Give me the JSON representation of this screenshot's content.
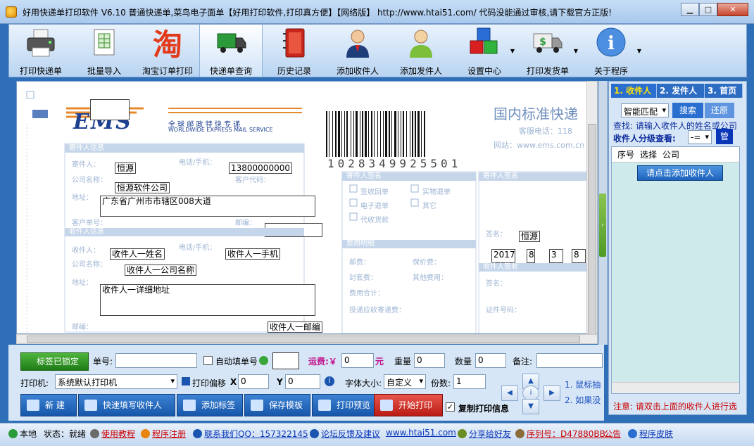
{
  "window": {
    "title": "好用快递单打印软件 V6.10 普通快递单,菜鸟电子面单【好用打印软件,打印真方便】【网络版】   http://www.htai51.com/  代码没能通过审核,请下载官方正版!"
  },
  "toolbar": {
    "items": [
      {
        "label": "打印快递单",
        "icon": "printer-icon"
      },
      {
        "label": "批量导入",
        "icon": "spreadsheet-icon"
      },
      {
        "label": "淘宝订单打印",
        "icon": "taobao-icon",
        "glyph": "淘"
      },
      {
        "label": "快递单查询",
        "icon": "delivery-truck-icon"
      },
      {
        "label": "历史记录",
        "icon": "notebook-icon"
      },
      {
        "label": "添加收件人",
        "icon": "user-icon"
      },
      {
        "label": "添加发件人",
        "icon": "sender-user-icon"
      },
      {
        "label": "设置中心",
        "icon": "cubes-icon"
      },
      {
        "label": "打印发货单",
        "icon": "money-truck-icon"
      },
      {
        "label": "关于程序",
        "icon": "info-icon",
        "glyph": "i"
      }
    ]
  },
  "waybill": {
    "brand": "EMS",
    "brand_sub_cn": "全 球 邮 政 特 快 专 递",
    "brand_sub_en": "WORLDWIDE EXPRESS MAIL SERVICE",
    "header_cn": "国内标准快递",
    "hotline": "客服电话：118",
    "website": "网站：www.ems.com.cn",
    "barcode_number": "1028349925501",
    "sender_name": "恒源",
    "sender_phone": "13800000000",
    "sender_company": "恒源软件公司",
    "sender_address": "广东省广州市市辖区008大道",
    "recv_name": "收件人一姓名",
    "recv_phone": "收件人一手机",
    "recv_company": "收件人一公司名称",
    "recv_address": "收件人一详细地址",
    "recv_zip": "收件人一邮编",
    "sign_name": "恒源",
    "date_year": "2017",
    "date_month": "8",
    "date_day": "3",
    "date_extra": "8",
    "labels": {
      "sender_section": "寄件人信息",
      "sender_name": "寄件人：",
      "sender_phone": "电话/手机：",
      "sender_company": "公司名称：",
      "sender_address": "地址：",
      "customer_no": "客户单号：",
      "zip": "邮编：",
      "recv_section": "收件人信息",
      "recv_name": "收件人：",
      "recv_phone": "电话/手机：",
      "recv_company": "公司名称：",
      "recv_address": "地址：",
      "cust_no2": "客户代码：",
      "consign_section": "寄件人签名",
      "signed": "签名：",
      "opt1": "签收回单",
      "opt2": "实物退单",
      "opt3": "电子退单",
      "opt4": "其它",
      "opt5": "代收货款",
      "fee_section": "费用明细",
      "postage": "邮费：",
      "insure": "保价费：",
      "packing": "封套费：",
      "other": "其他费用：",
      "total": "费用合计：",
      "recvamount": "投递应收寄递费：",
      "recipient_section": "收件人签收",
      "recipient_sign": "签名：",
      "id_no": "证件号码："
    }
  },
  "controls": {
    "lock_button": "标签已锁定",
    "order_no_label": "单号:",
    "order_no_value": "",
    "auto_fill_label": "自动填单号",
    "freight_label": "运费:￥",
    "freight_value": "0",
    "freight_unit": "元",
    "weight_label": "重量",
    "weight_value": "0",
    "quantity_label": "数量",
    "quantity_value": "0",
    "remark_label": "备注:",
    "printer_label": "打印机:",
    "printer_value": "系统默认打印机",
    "offset_label": "打印偏移",
    "offset_x_label": "X",
    "offset_x": "0",
    "offset_y_label": "Y",
    "offset_y": "0",
    "font_size_label": "字体大小:",
    "font_size_value": "自定义",
    "copies_label": "份数:",
    "copies_value": "1",
    "btn_new": "新  建",
    "btn_quick_fill": "快速填写收件人",
    "btn_add_label": "添加标签",
    "btn_save_template": "保存模板",
    "btn_print_preview": "打印预览",
    "btn_start_print": "开始打印",
    "copy_print_label": "复制打印信息",
    "hint1": "1. 鼠标抽",
    "hint2": "2. 如果没"
  },
  "right_panel": {
    "tabs": [
      "1. 收件人",
      "2. 发件人",
      "3. 首页"
    ],
    "match_select": "智能匹配",
    "search_button": "搜索",
    "reset_button": "还原",
    "search_hint": "查找: 请输入收件人的姓名或公司",
    "level_label": "收件人分级查看:",
    "level_value": "-=",
    "manage_button": "管",
    "columns": [
      "序号",
      "选择",
      "公司"
    ],
    "add_recipient_button": "请点击添加收件人",
    "note": "注意: 请双击上面的收件人进行选"
  },
  "statusbar": {
    "local": "本地",
    "state": "状态：就绪",
    "tutorial": "使用教程",
    "register": "程序注册",
    "contact": "联系我们QQ：157322145",
    "forum": "论坛反馈及建议",
    "website": "www.htai51.com",
    "share": "分享给好友",
    "serial": "序列号：D47880BB...",
    "notice": "公告",
    "skin": "程序皮肤"
  },
  "colors": {
    "accent_blue": "#2a6ed0",
    "ems_orange": "#e58a2e",
    "ems_blue": "#1c3f8f"
  }
}
